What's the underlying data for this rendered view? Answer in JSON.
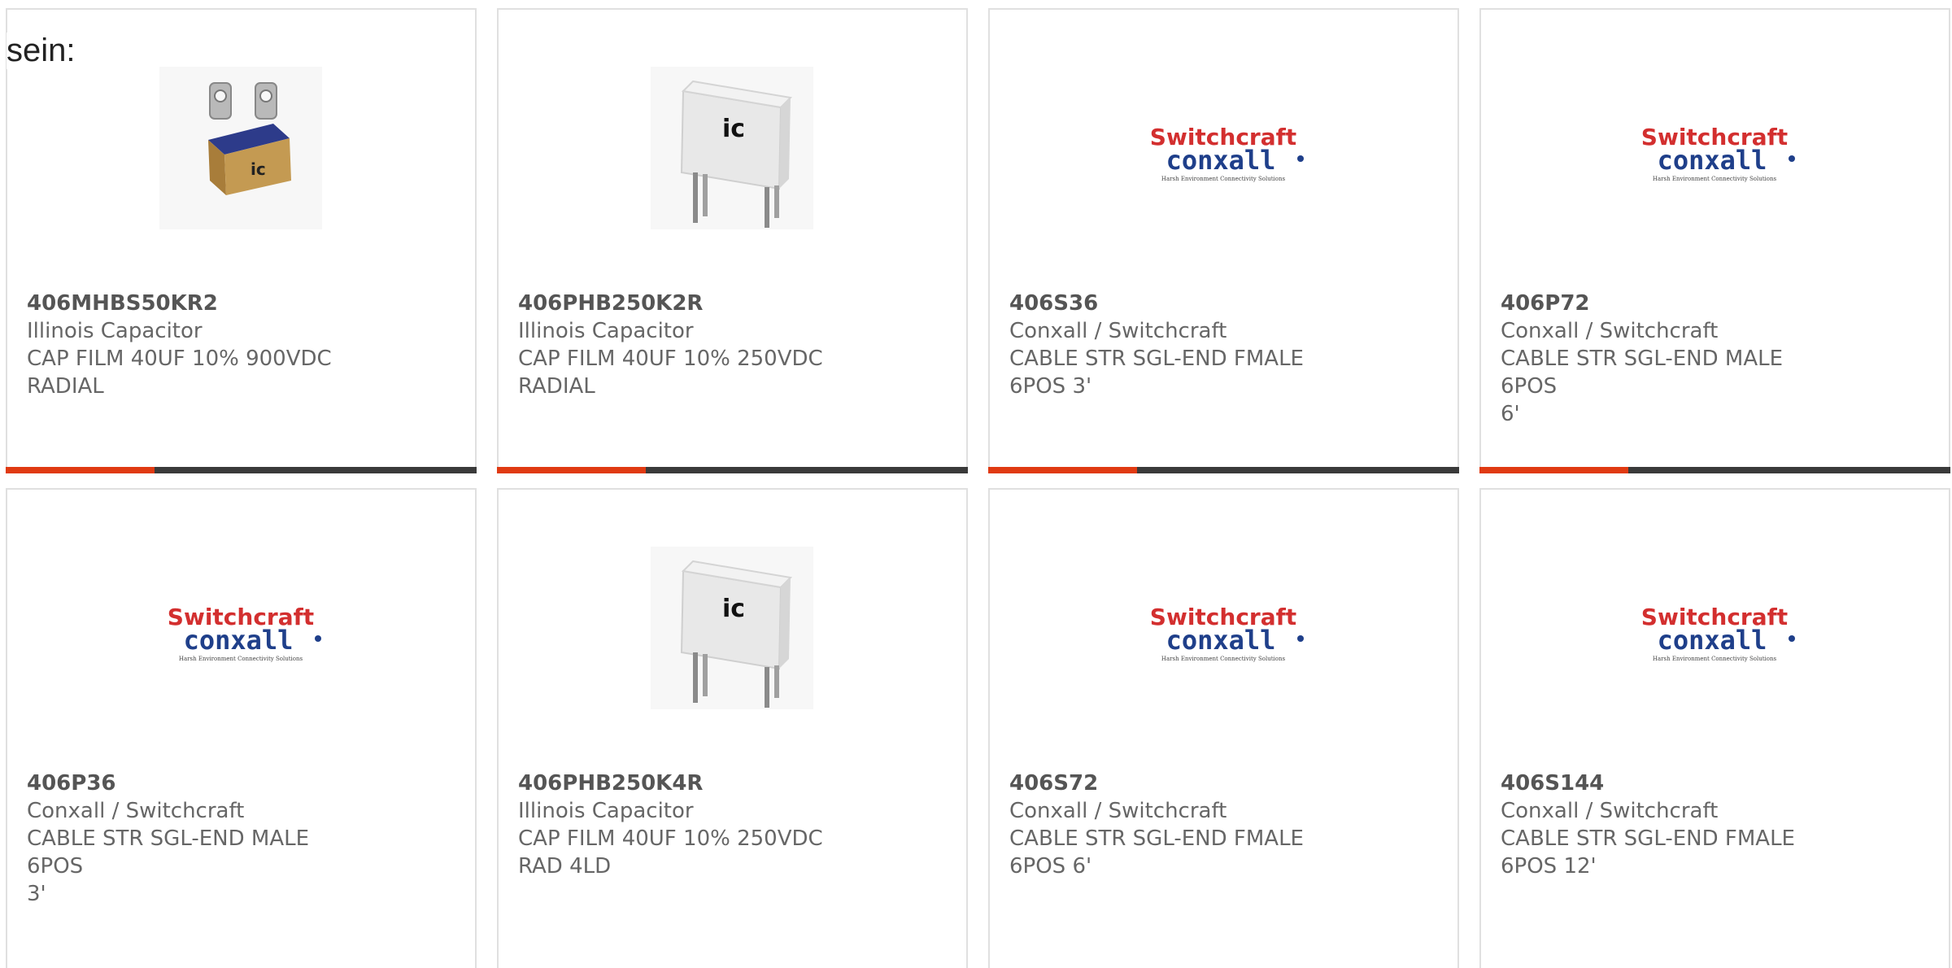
{
  "intro_text": "sein:",
  "accent_color": "#e03a12",
  "products": [
    {
      "part": "406MHBS50KR2",
      "manufacturer": "Illinois Capacitor",
      "desc1": "CAP FILM 40UF 10% 900VDC",
      "desc2": "RADIAL",
      "image": "mhbs-icon"
    },
    {
      "part": "406PHB250K2R",
      "manufacturer": "Illinois Capacitor",
      "desc1": "CAP FILM 40UF 10% 250VDC",
      "desc2": "RADIAL",
      "image": "phb-icon"
    },
    {
      "part": "406S36",
      "manufacturer": "Conxall / Switchcraft",
      "desc1": "CABLE STR SGL-END FMALE",
      "desc2": "6POS 3'",
      "image": "switchcraft-logo"
    },
    {
      "part": "406P72",
      "manufacturer": "Conxall / Switchcraft",
      "desc1": "CABLE STR SGL-END MALE 6POS",
      "desc2": "6'",
      "image": "switchcraft-logo"
    },
    {
      "part": "406P36",
      "manufacturer": "Conxall / Switchcraft",
      "desc1": "CABLE STR SGL-END MALE 6POS",
      "desc2": "3'",
      "image": "switchcraft-logo"
    },
    {
      "part": "406PHB250K4R",
      "manufacturer": "Illinois Capacitor",
      "desc1": "CAP FILM 40UF 10% 250VDC",
      "desc2": "RAD 4LD",
      "image": "phb-icon"
    },
    {
      "part": "406S72",
      "manufacturer": "Conxall / Switchcraft",
      "desc1": "CABLE STR SGL-END FMALE",
      "desc2": "6POS 6'",
      "image": "switchcraft-logo"
    },
    {
      "part": "406S144",
      "manufacturer": "Conxall / Switchcraft",
      "desc1": "CABLE STR SGL-END FMALE",
      "desc2": "6POS 12'",
      "image": "switchcraft-logo"
    }
  ],
  "logo": {
    "line1": "Switchcraft",
    "line2": "conxall",
    "tagline": "Harsh Environment Connectivity Solutions"
  },
  "capacitor_mark": "ic"
}
